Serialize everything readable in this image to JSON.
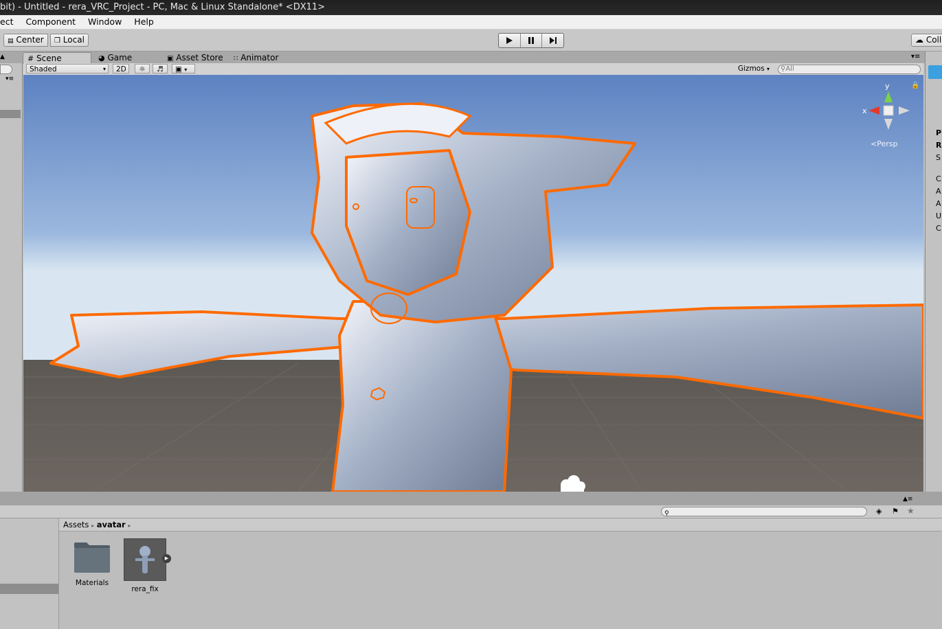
{
  "window": {
    "title": "bit) - Untitled - rera_VRC_Project - PC, Mac & Linux Standalone* <DX11>"
  },
  "menu": {
    "items": [
      "ect",
      "Component",
      "Window",
      "Help"
    ]
  },
  "toolbar": {
    "pivot_label": "Center",
    "space_label": "Local",
    "collab_label": "Coll"
  },
  "scene_tabs": [
    {
      "label": "Scene",
      "icon": "grid-icon",
      "active": true
    },
    {
      "label": "Game",
      "icon": "pacman-icon",
      "active": false
    },
    {
      "label": "Asset Store",
      "icon": "shop-icon",
      "active": false
    },
    {
      "label": "Animator",
      "icon": "animator-icon",
      "active": false
    }
  ],
  "scene_bar": {
    "shading_mode": "Shaded",
    "mode_2d": "2D",
    "gizmos_label": "Gizmos",
    "search_placeholder": "All"
  },
  "viewport": {
    "projection_label": "Persp",
    "selection_outline_color": "#ff6a00",
    "sky_top_color": "#5f86c4",
    "ground_color": "#6b655f"
  },
  "inspector_letters": [
    "P",
    "R",
    "S",
    "C",
    "A",
    "A",
    "U",
    "C"
  ],
  "project": {
    "breadcrumb": [
      "Assets",
      "avatar"
    ],
    "assets": [
      {
        "name": "Materials",
        "type": "folder"
      },
      {
        "name": "rera_fix",
        "type": "model"
      }
    ]
  }
}
